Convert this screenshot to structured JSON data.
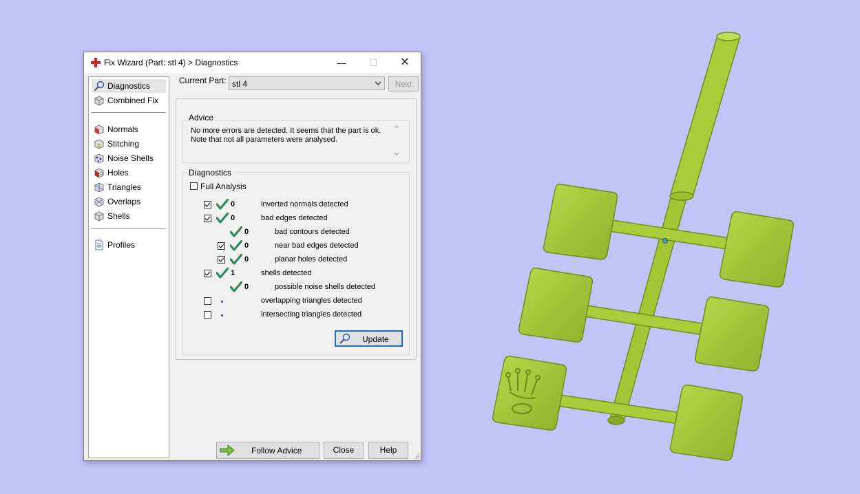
{
  "window": {
    "title": "Fix Wizard (Part: stl 4) > Diagnostics",
    "controls": {
      "minimize": "—",
      "maximize": "☐",
      "close": "✕"
    }
  },
  "nav": {
    "items": [
      {
        "label": "Diagnostics",
        "icon": "magnifier-icon",
        "selected": true
      },
      {
        "label": "Combined Fix",
        "icon": "cube-icon"
      },
      {
        "label": "Normals",
        "icon": "normals-cube-icon"
      },
      {
        "label": "Stitching",
        "icon": "stitching-cube-icon"
      },
      {
        "label": "Noise Shells",
        "icon": "noise-shells-icon"
      },
      {
        "label": "Holes",
        "icon": "holes-cube-icon"
      },
      {
        "label": "Triangles",
        "icon": "triangles-cube-icon"
      },
      {
        "label": "Overlaps",
        "icon": "overlaps-cube-icon"
      },
      {
        "label": "Shells",
        "icon": "shells-cube-icon"
      },
      {
        "label": "Profiles",
        "icon": "document-icon"
      }
    ]
  },
  "part": {
    "label": "Current Part:",
    "value": "stl 4",
    "next": "Next"
  },
  "advice": {
    "title": "Advice",
    "lines": [
      "No more errors are detected. It seems that the part is ok.",
      "Note that not all parameters were analysed."
    ]
  },
  "diagnostics": {
    "title": "Diagnostics",
    "full_analysis": "Full Analysis",
    "rows": [
      {
        "checkbox": true,
        "checked": true,
        "ok": true,
        "count": "0",
        "label": "inverted normals detected",
        "indent": 0
      },
      {
        "checkbox": true,
        "checked": true,
        "ok": true,
        "count": "0",
        "label": "bad edges detected",
        "indent": 0
      },
      {
        "checkbox": false,
        "checked": false,
        "ok": true,
        "count": "0",
        "label": "bad contours detected",
        "indent": 1
      },
      {
        "checkbox": true,
        "checked": true,
        "ok": true,
        "count": "0",
        "label": "near bad edges detected",
        "indent": 1
      },
      {
        "checkbox": true,
        "checked": true,
        "ok": true,
        "count": "0",
        "label": "planar holes detected",
        "indent": 1
      },
      {
        "checkbox": true,
        "checked": true,
        "ok": true,
        "count": "1",
        "label": "shells detected",
        "indent": 0
      },
      {
        "checkbox": false,
        "checked": false,
        "ok": true,
        "count": "0",
        "label": "possible noise shells detected",
        "indent": 1
      },
      {
        "checkbox": true,
        "checked": false,
        "ok": false,
        "count": "",
        "label": "overlapping triangles detected",
        "indent": 0
      },
      {
        "checkbox": true,
        "checked": false,
        "ok": false,
        "count": "",
        "label": "intersecting triangles detected",
        "indent": 0
      }
    ],
    "update": "Update"
  },
  "footer": {
    "follow_advice": "Follow Advice",
    "close": "Close",
    "help": "Help"
  },
  "colors": {
    "background": "#c4c3f8",
    "model": "#a8cc3a",
    "check": "#2e8b57",
    "accent": "#1b6dc9"
  }
}
